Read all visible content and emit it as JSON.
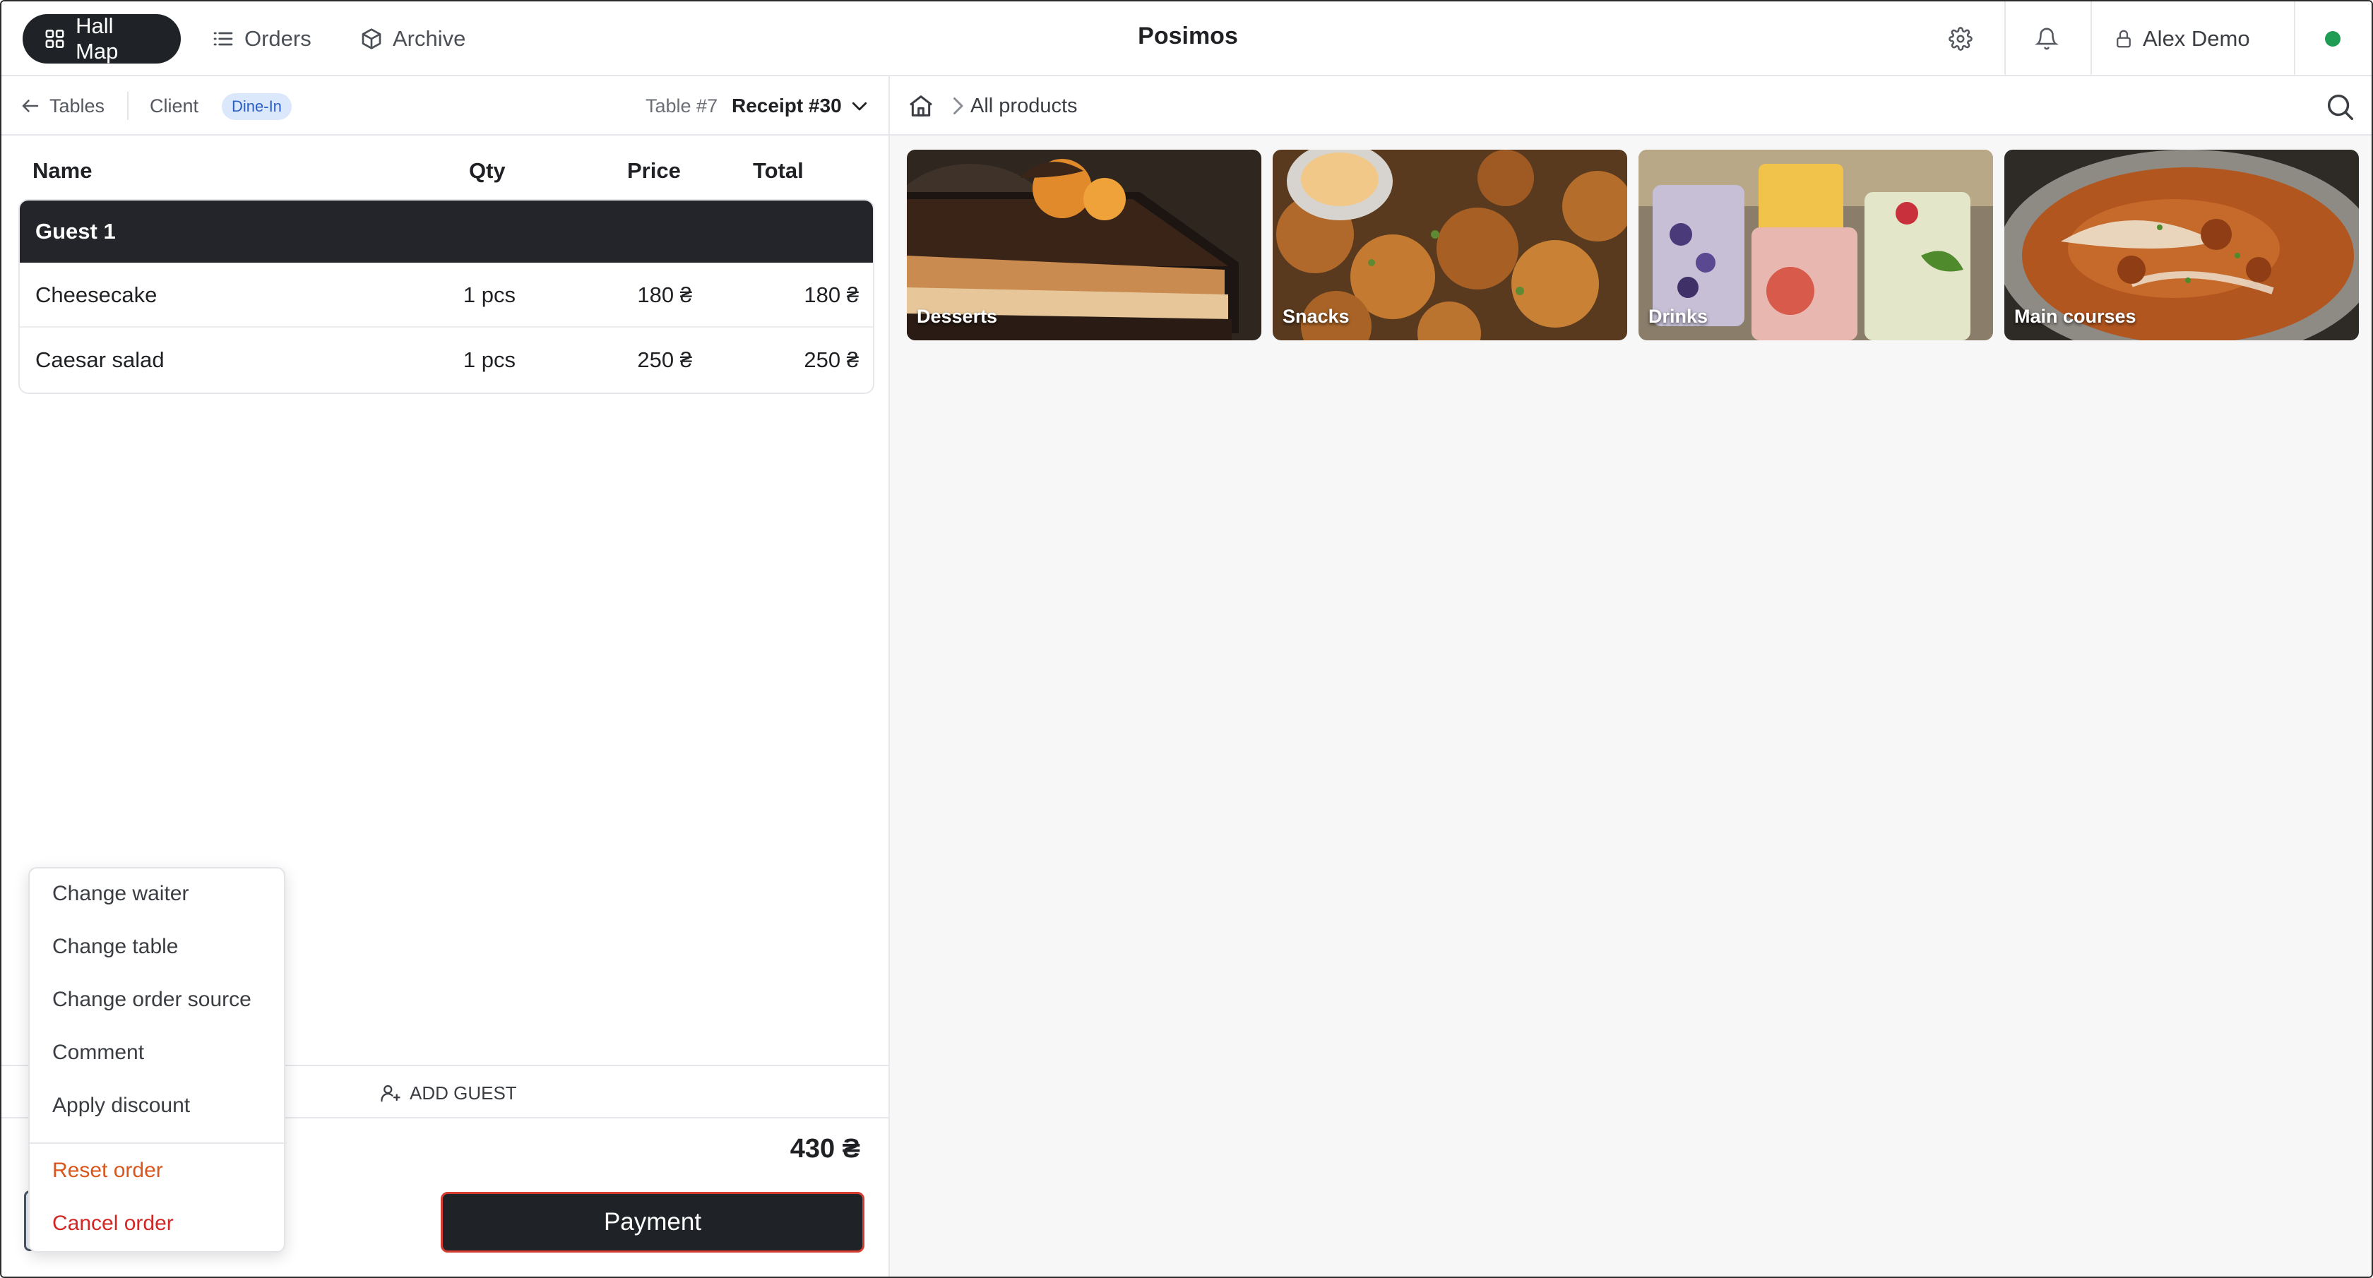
{
  "topbar": {
    "nav": [
      {
        "label": "Hall Map",
        "icon": "grid-icon"
      },
      {
        "label": "Orders",
        "icon": "list-icon"
      },
      {
        "label": "Archive",
        "icon": "box-icon"
      }
    ],
    "title": "Posimos",
    "user": "Alex Demo",
    "status_color": "#1f9d55"
  },
  "order": {
    "back_label": "Tables",
    "client_label": "Client",
    "order_type": "Dine-In",
    "table": "Table #7",
    "receipt": "Receipt #30",
    "columns": [
      "Name",
      "Qty",
      "Price",
      "Total"
    ],
    "guest": "Guest 1",
    "items": [
      {
        "name": "Cheesecake",
        "qty": "1 pcs",
        "price": "180 ₴",
        "total": "180 ₴"
      },
      {
        "name": "Caesar salad",
        "qty": "1 pcs",
        "price": "250 ₴",
        "total": "250 ₴"
      }
    ],
    "add_guest": "ADD GUEST",
    "total": "430 ₴",
    "payment": "Payment"
  },
  "menu": {
    "items": [
      "Change waiter",
      "Change table",
      "Change order source",
      "Comment",
      "Apply discount"
    ],
    "reset": "Reset order",
    "cancel": "Cancel order"
  },
  "products": {
    "breadcrumb": "All products",
    "categories": [
      {
        "label": "Desserts"
      },
      {
        "label": "Snacks"
      },
      {
        "label": "Drinks"
      },
      {
        "label": "Main courses"
      }
    ]
  },
  "colors": {
    "dark": "#1f2328",
    "accent_blue": "#2b5fc7",
    "warning": "#d9571c",
    "danger": "#d32626"
  }
}
